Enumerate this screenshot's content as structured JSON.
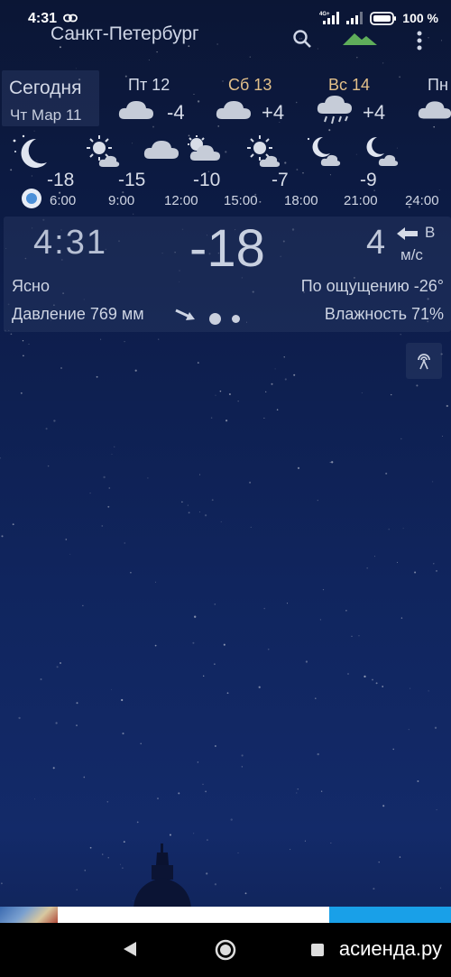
{
  "status_bar": {
    "time": "4:31",
    "network_label": "4G+",
    "battery": "100 %",
    "link_icon": "link-icon",
    "signal_icon": "signal-icon",
    "battery_icon": "battery-icon"
  },
  "app_bar": {
    "city": "Санкт-Петербург",
    "search_icon": "search-icon",
    "app_icon": "mountain-icon",
    "menu_icon": "more-vert-icon"
  },
  "today": {
    "title": "Сегодня",
    "date": "Чт Мар 11"
  },
  "days": [
    {
      "name": "Пт 12",
      "temp": "-4",
      "icon": "cloud-icon",
      "color": "#d6dbe7"
    },
    {
      "name": "Сб 13",
      "temp": "+4",
      "icon": "cloud-icon",
      "color": "#e3c08a"
    },
    {
      "name": "Вс 14",
      "temp": "+4",
      "icon": "rain-cloud-icon",
      "color": "#e3c08a"
    },
    {
      "name": "Пн",
      "temp": "",
      "icon": "cloud-icon",
      "color": "#d6dbe7"
    }
  ],
  "hourly": [
    {
      "time": "6:00",
      "temp": "-18",
      "icon": "moon-icon"
    },
    {
      "time": "9:00",
      "temp": "-15",
      "icon": "sun-cloud-icon"
    },
    {
      "time": "12:00",
      "temp": "-10",
      "icon": "cloud-icon"
    },
    {
      "time": "15:00",
      "temp": "-7",
      "icon": "sun-cloud-icon"
    },
    {
      "time": "18:00",
      "temp": "-9",
      "icon": "moon-icon"
    },
    {
      "time": "21:00",
      "temp": "",
      "icon": "moon-cloud-icon"
    },
    {
      "time": "24:00",
      "temp": "",
      "icon": ""
    }
  ],
  "current": {
    "time": "4:31",
    "temperature": "-18",
    "wind_speed": "4",
    "wind_direction": "В",
    "wind_unit": "м/с",
    "condition": "Ясно",
    "feels_like": "По ощущению -26°",
    "pressure": "Давление 769 мм",
    "humidity": "Влажность 71%"
  },
  "radio_button": {
    "icon": "broadcast-icon"
  },
  "ad_banner": {
    "accent_color": "#19a0e8"
  },
  "nav": {
    "back_icon": "back-icon",
    "home_icon": "home-icon",
    "recents_icon": "recents-icon",
    "watermark": "асиенда.ру"
  }
}
